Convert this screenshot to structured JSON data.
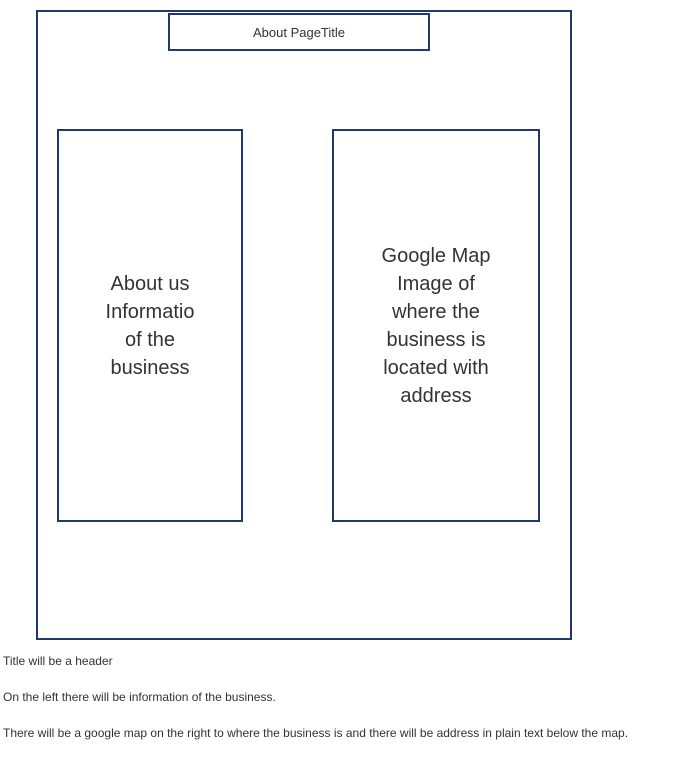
{
  "wireframe": {
    "title_box": "About PageTitle",
    "left_panel": {
      "lines": [
        "About us",
        "Informatio",
        "of the",
        "business"
      ]
    },
    "right_panel": {
      "lines": [
        "Google Map",
        "Image of",
        "where the",
        "business is",
        "located with",
        "address"
      ]
    }
  },
  "notes": [
    "Title will be a header",
    "On the left there will be information of the business.",
    "There will be a google map on the right to where the business is and there will be address in plain text below the map."
  ],
  "colors": {
    "border": "#1f3a6b",
    "text": "#333333",
    "background": "#ffffff"
  }
}
